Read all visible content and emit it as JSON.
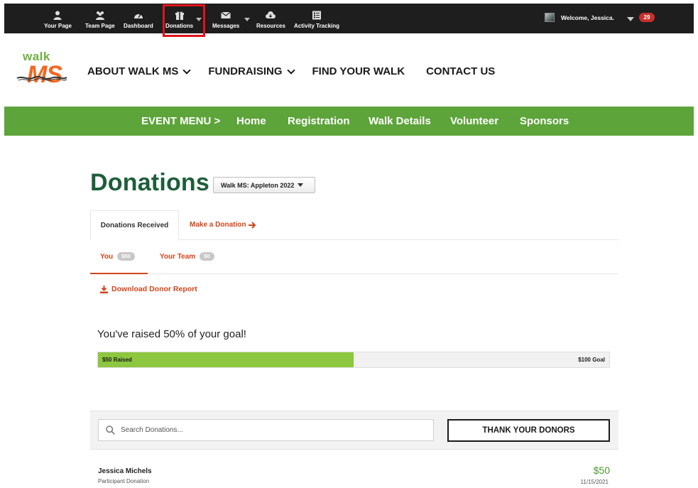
{
  "toolbar": {
    "items": [
      {
        "label": "Your Page",
        "icon": "user-icon"
      },
      {
        "label": "Team Page",
        "icon": "team-icon"
      },
      {
        "label": "Dashboard",
        "icon": "dashboard-icon"
      },
      {
        "label": "Donations",
        "icon": "gift-icon",
        "highlighted": true
      },
      {
        "label": "Messages",
        "icon": "envelope-icon"
      },
      {
        "label": "Resources",
        "icon": "cloud-icon"
      },
      {
        "label": "Activity Tracking",
        "icon": "checklist-icon"
      }
    ],
    "welcome": "Welcome, Jessica.",
    "notifications": "29"
  },
  "logo": {
    "walk": "walk",
    "ms": "MS"
  },
  "mainnav": {
    "items": [
      {
        "label": "ABOUT WALK MS",
        "dropdown": true
      },
      {
        "label": "FUNDRAISING",
        "dropdown": true
      },
      {
        "label": "FIND YOUR WALK",
        "dropdown": false
      },
      {
        "label": "CONTACT US",
        "dropdown": false
      }
    ]
  },
  "eventbar": {
    "items": [
      "EVENT MENU >",
      "Home",
      "Registration",
      "Walk Details",
      "Volunteer",
      "Sponsors"
    ]
  },
  "donations": {
    "title": "Donations",
    "event_selected": "Walk MS: Appleton 2022",
    "tab_received": "Donations Received",
    "tab_make": "Make a Donation",
    "sub_you": "You",
    "sub_you_amount": "$50",
    "sub_team": "Your Team",
    "sub_team_amount": "$0",
    "download": "Download Donor Report",
    "goal_message": "You've raised 50% of your goal!",
    "progress_fraction": 0.5,
    "raised_label": "$50 Raised",
    "goal_label": "$100 Goal",
    "search_placeholder": "Search Donations...",
    "thank_button": "THANK YOUR DONORS",
    "donors": [
      {
        "name": "Jessica Michels",
        "type": "Participant Donation",
        "amount": "$50",
        "date": "11/15/2021"
      }
    ]
  },
  "colors": {
    "toolbar_bg": "#1e1e1e",
    "event_green": "#5da43a",
    "title_green": "#1d5e3a",
    "accent_orange": "#d4441c",
    "progress_green": "#8dc63f",
    "highlight_red": "#e0121b"
  }
}
